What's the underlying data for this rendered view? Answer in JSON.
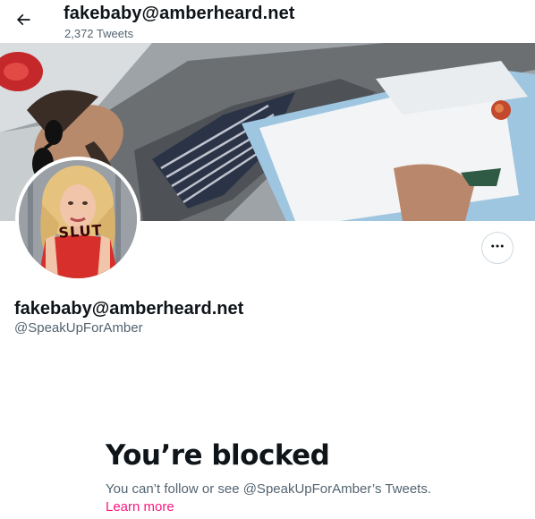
{
  "header": {
    "title": "fakebaby@amberheard.net",
    "tweet_count": "2,372 Tweets",
    "back_icon": "arrow-left-icon"
  },
  "banner": {
    "description_icon": "banner-photo"
  },
  "avatar": {
    "shirt_text": "SLUT"
  },
  "profile": {
    "display_name": "fakebaby@amberheard.net",
    "handle": "@SpeakUpForAmber",
    "more_icon": "ellipsis-icon"
  },
  "blocked": {
    "title": "You’re blocked",
    "message": "You can’t follow or see @SpeakUpForAmber’s Tweets.",
    "learn_more": "Learn more"
  },
  "colors": {
    "text_primary": "#0f1419",
    "text_secondary": "#536471",
    "accent_link": "#f91880",
    "border": "#cfd9de"
  }
}
